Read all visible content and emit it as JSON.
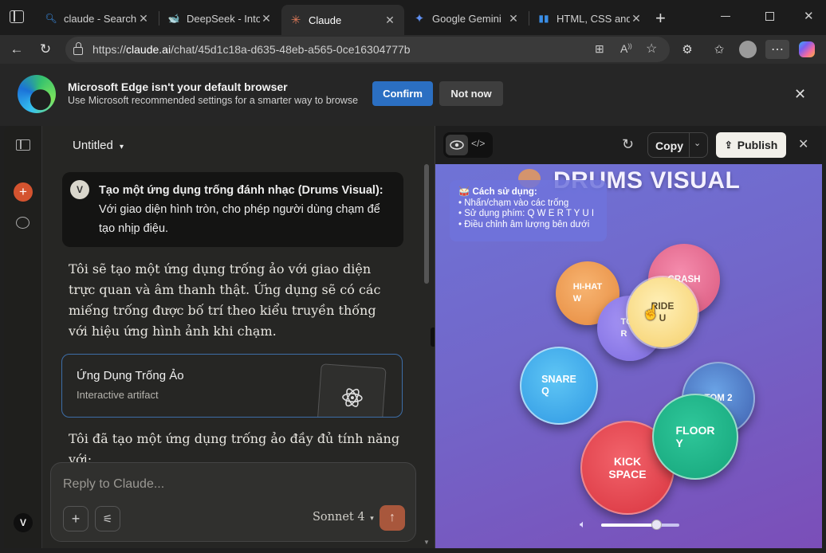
{
  "browser": {
    "tabs": [
      {
        "title": "claude - Search",
        "favicon": "search-icon"
      },
      {
        "title": "DeepSeek - Into t",
        "favicon": "deepseek-icon"
      },
      {
        "title": "Claude",
        "favicon": "claude-icon"
      },
      {
        "title": "Google Gemini",
        "favicon": "gemini-icon"
      },
      {
        "title": "HTML, CSS and Ja",
        "favicon": "chart-icon"
      }
    ],
    "url_prefix": "https://",
    "url_host": "claude.ai",
    "url_path": "/chat/45d1c18a-d635-48eb-a565-0ce16304777b"
  },
  "banner": {
    "title": "Microsoft Edge isn't your default browser",
    "subtitle": "Use Microsoft recommended settings for a smarter way to browse",
    "confirm": "Confirm",
    "not_now": "Not now"
  },
  "chat": {
    "title": "Untitled",
    "user_initial": "V",
    "user_msg_bold": "Tạo một ứng dụng trống đánh nhạc (Drums Visual):",
    "user_msg_rest": " Với giao diện hình tròn, cho phép người dùng chạm để tạo nhịp điệu.",
    "reply1": "Tôi sẽ tạo một ứng dụng trống ảo với giao diện trực quan và âm thanh thật. Ứng dụng sẽ có các miếng trống được bố trí theo kiểu truyền thống với hiệu ứng hình ảnh khi chạm.",
    "artifact_title": "Ứng Dụng Trống Ảo",
    "artifact_sub": "Interactive artifact",
    "reply2": "Tôi đã tạo một ứng dụng trống ảo đầy đủ tính năng với:",
    "composer_placeholder": "Reply to Claude...",
    "model": "Sonnet 4",
    "account_initial": "V"
  },
  "artifact": {
    "copy": "Copy",
    "publish": "Publish",
    "app_title": "DRUMS VISUAL",
    "help_title": "Cách sử dụng:",
    "help_lines": [
      "• Nhấn/chạm vào các trống",
      "• Sử dụng phím: Q W E R T Y U I",
      "• Điều chỉnh âm lượng bên dưới"
    ],
    "drums": {
      "hihat": "HI-HAT\nW",
      "crash": "CRASH",
      "tom": "TO\nR",
      "ride": "RIDE\nU",
      "snare": "SNARE\nQ",
      "tom2": "TOM 2",
      "floor": "FLOOR\nY",
      "kick": "KICK\nSPACE"
    },
    "volume": 0.7
  },
  "colors": {
    "accent_blue": "#2b6fc2",
    "claude_orange": "#d4532f",
    "send_button": "#a8573c"
  }
}
